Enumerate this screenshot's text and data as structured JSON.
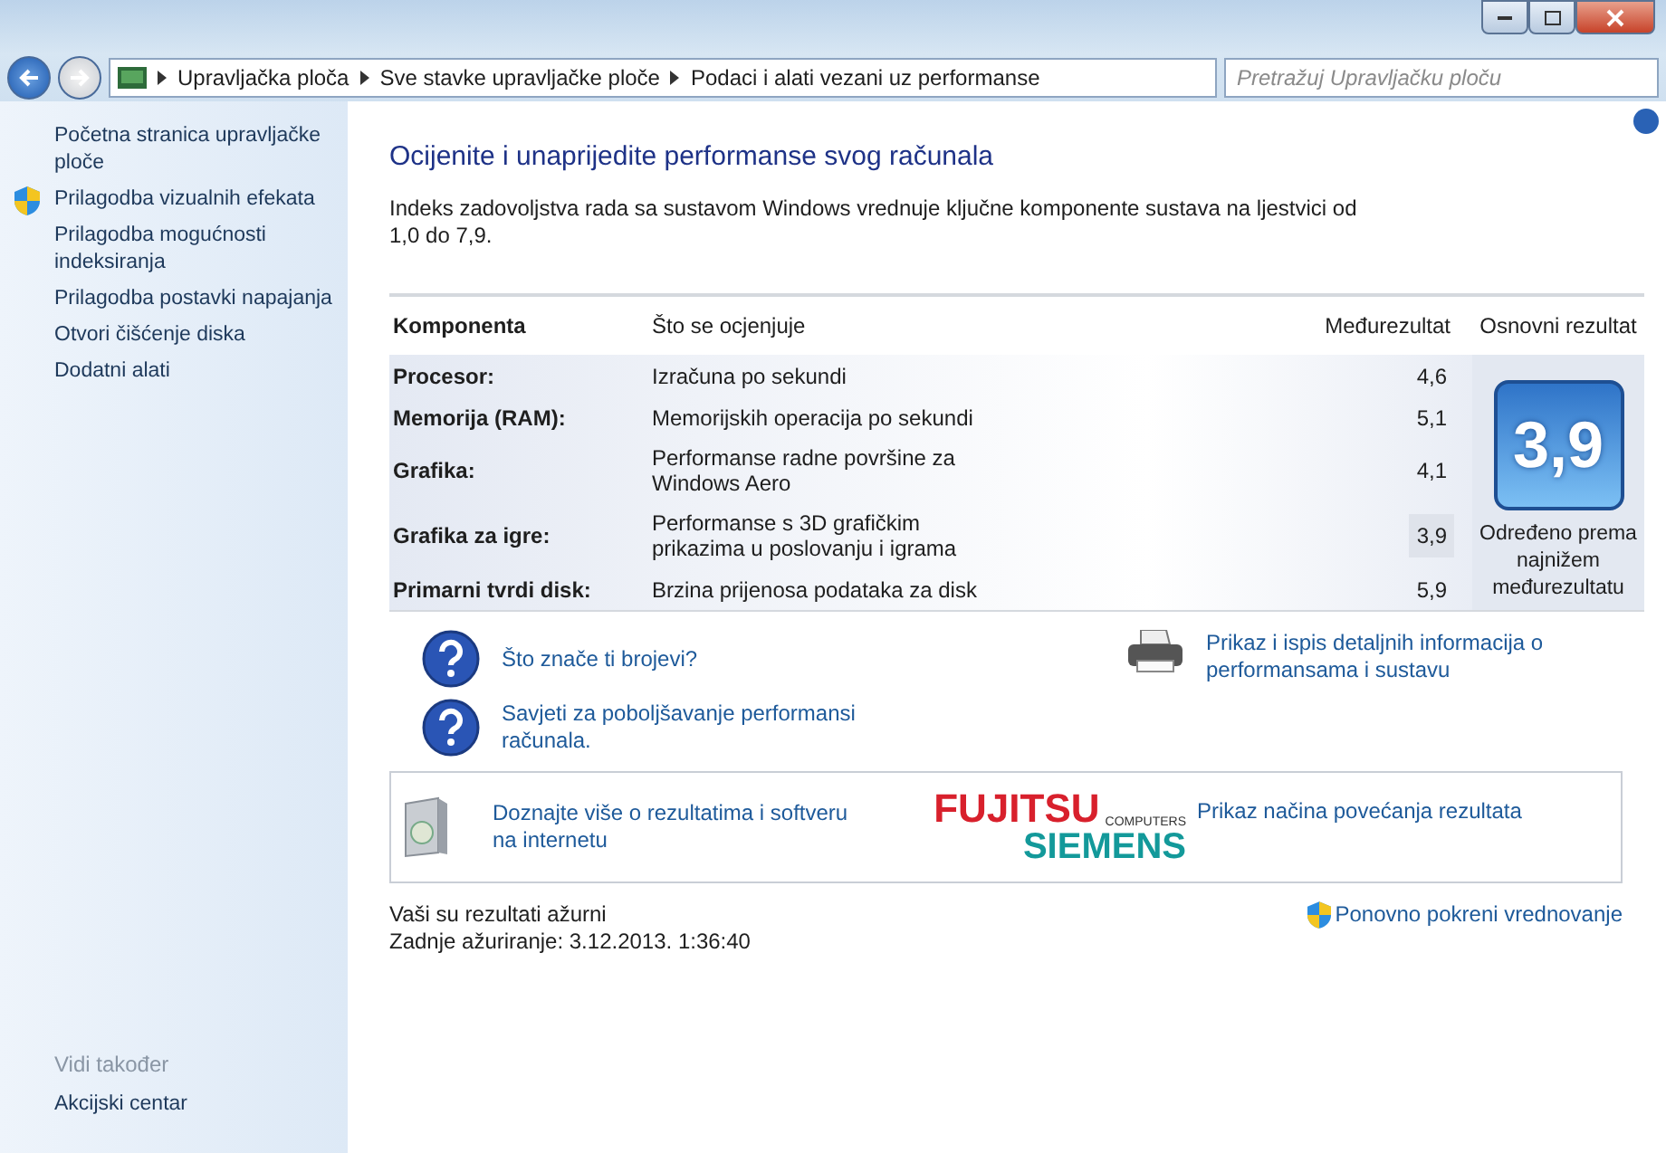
{
  "address_bar": {
    "crumbs": [
      "Upravljačka ploča",
      "Sve stavke upravljačke ploče",
      "Podaci i alati vezani uz performanse"
    ],
    "search": {
      "placeholder": "Pretražuj Upravljačku ploču"
    }
  },
  "sidebar": {
    "items": [
      {
        "label": "Početna stranica upravljačke ploče",
        "kind": "plain"
      },
      {
        "label": "Prilagodba vizualnih efekata",
        "kind": "shield"
      },
      {
        "label": "Prilagodba mogućnosti indeksiranja",
        "kind": "plain"
      },
      {
        "label": "Prilagodba postavki napajanja",
        "kind": "plain"
      },
      {
        "label": "Otvori čišćenje diska",
        "kind": "plain"
      },
      {
        "label": "Dodatni alati",
        "kind": "plain"
      }
    ],
    "see_also": {
      "heading": "Vidi također",
      "items": [
        "Akcijski centar"
      ]
    }
  },
  "title": "Ocijenite i unaprijedite performanse svog računala",
  "intro": "Indeks zadovoljstva rada sa sustavom Windows vrednuje ključne komponente sustava na ljestvici od 1,0 do 7,9.",
  "table": {
    "columns": [
      "Komponenta",
      "Što se ocjenjuje",
      "Međurezultat",
      "Osnovni rezultat"
    ],
    "rows": [
      {
        "component": "Procesor:",
        "rated": "Izračuna po sekundi",
        "subscore": "4,6",
        "lowest": false
      },
      {
        "component": "Memorija (RAM):",
        "rated": "Memorijskih operacija po sekundi",
        "subscore": "5,1",
        "lowest": false
      },
      {
        "component": "Grafika:",
        "rated": "Performanse radne površine za Windows Aero",
        "subscore": "4,1",
        "lowest": false
      },
      {
        "component": "Grafika za igre:",
        "rated": "Performanse s 3D grafičkim prikazima u poslovanju i igrama",
        "subscore": "3,9",
        "lowest": true
      },
      {
        "component": "Primarni tvrdi disk:",
        "rated": "Brzina prijenosa podataka za disk",
        "subscore": "5,9",
        "lowest": false
      }
    ],
    "base_score": "3,9",
    "base_note": "Određeno prema najnižem međurezultatu"
  },
  "help_links": [
    "Što znače ti brojevi?",
    "Savjeti za poboljšavanje performansi računala."
  ],
  "print_link": "Prikaz i ispis detaljnih informacija o performansama i sustavu",
  "online_box": {
    "link": "Doznajte više o rezultatima i softveru na internetu",
    "logo": {
      "top": "FUJITSU",
      "small": "COMPUTERS",
      "bottom": "SIEMENS"
    },
    "oem_link": "Prikaz načina povećanja rezultata"
  },
  "status": {
    "line1": "Vaši su rezultati ažurni",
    "line2": "Zadnje ažuriranje: 3.12.2013. 1:36:40",
    "rerun": "Ponovno pokreni vrednovanje"
  }
}
